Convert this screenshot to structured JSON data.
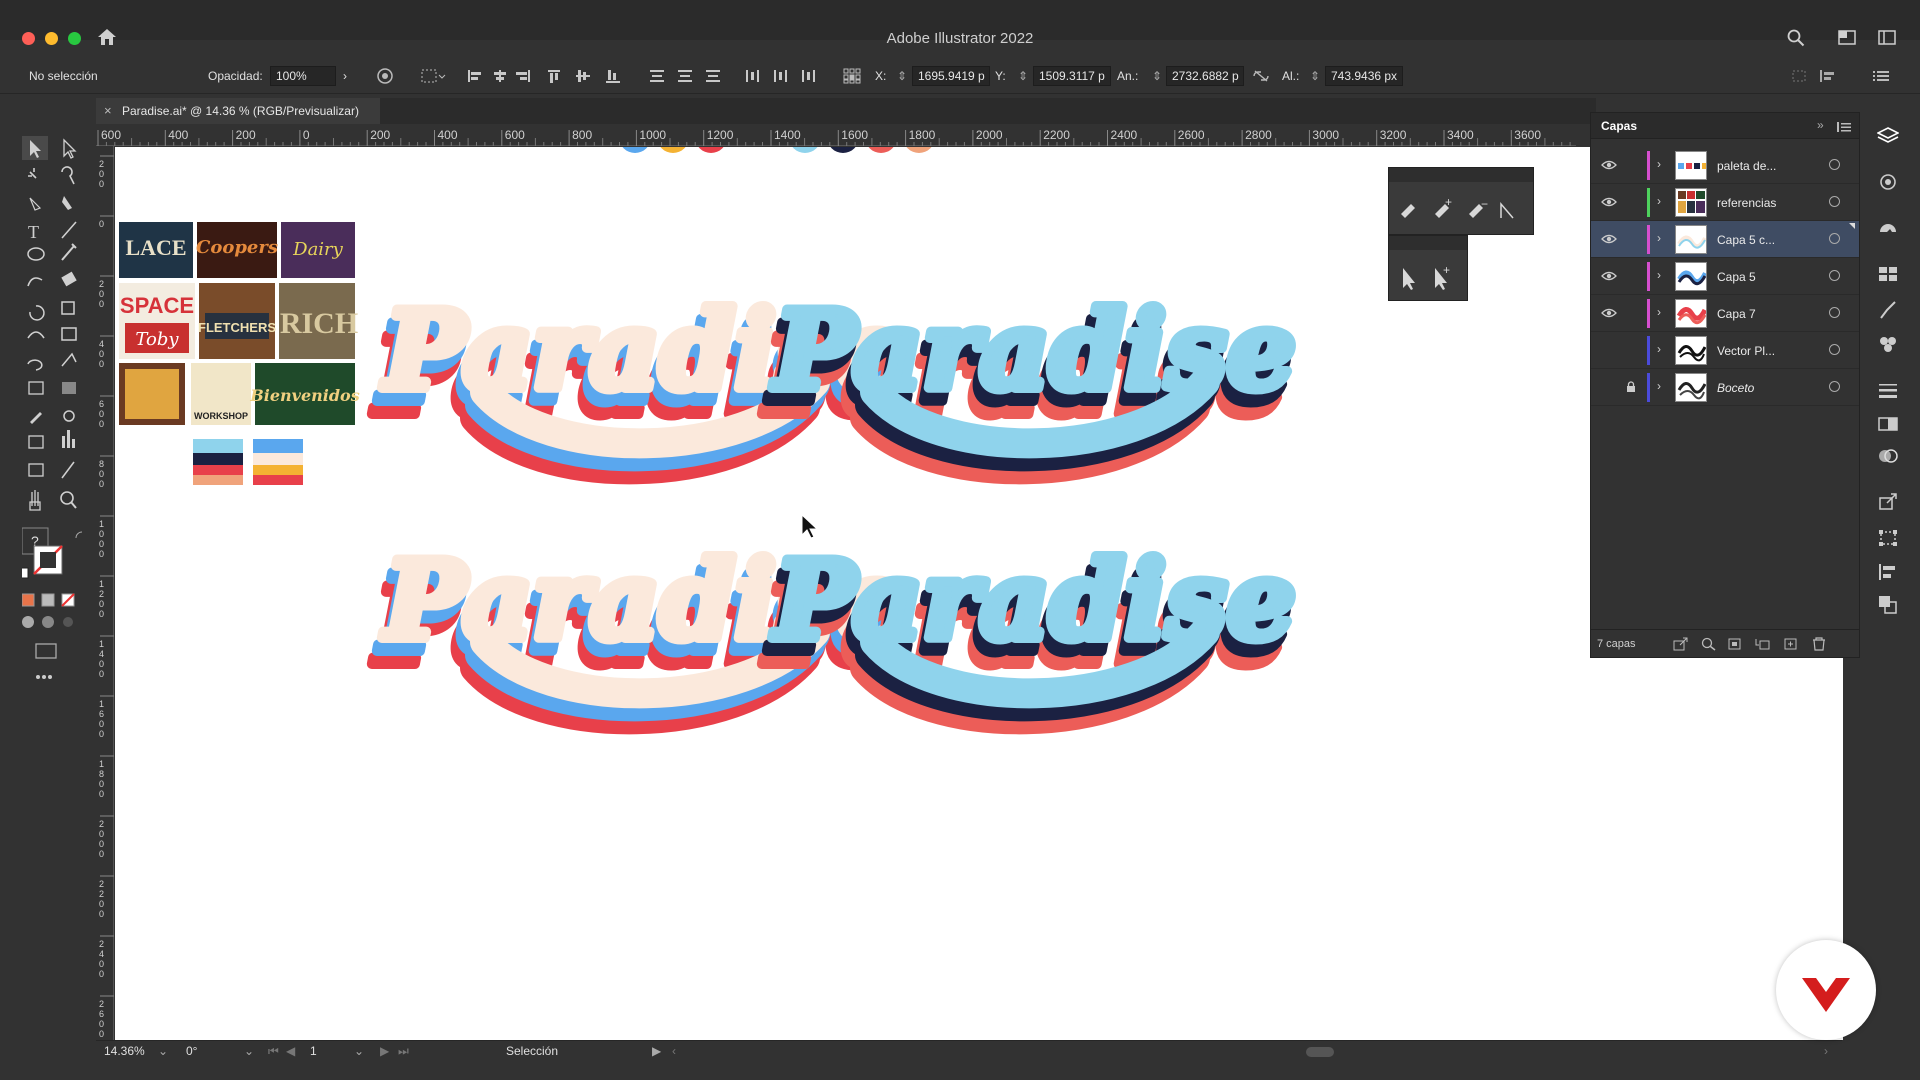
{
  "window": {
    "title": "Adobe Illustrator 2022"
  },
  "control_bar": {
    "selection": "No selección",
    "opacity_label": "Opacidad:",
    "opacity_value": "100%",
    "x_label": "X:",
    "x_value": "1695.9419 p",
    "y_label": "Y:",
    "y_value": "1509.3117 p",
    "w_label": "An.:",
    "w_value": "2732.6882 p",
    "h_label": "Al.:",
    "h_value": "743.9436 px"
  },
  "document_tab": {
    "title": "Paradise.ai* @ 14.36 % (RGB/Previsualizar)",
    "close": "×"
  },
  "ruler": {
    "h_ticks": [
      "600",
      "400",
      "200",
      "0",
      "200",
      "400",
      "600",
      "800",
      "1000",
      "1200",
      "1400",
      "1600",
      "1800",
      "2000",
      "2200",
      "2400",
      "2600",
      "2800",
      "3000",
      "3200",
      "3400",
      "3600"
    ],
    "v_ticks": [
      "200",
      "0",
      "200",
      "400",
      "600",
      "800",
      "1000",
      "1200",
      "1400",
      "1600",
      "1800",
      "2000",
      "2200",
      "2400",
      "2600"
    ]
  },
  "canvas": {
    "artwork_word": "Paradise",
    "reference_signs": [
      "LACE",
      "Coopers",
      "SPACE",
      "Toby",
      "FLETCHERS",
      "RICH",
      "Bienvenidos",
      "WORKSHOP"
    ],
    "colors": {
      "cream": "#fbe9dc",
      "blue": "#5aa7ee",
      "red": "#e8404a",
      "light_blue": "#8fd3ec",
      "navy": "#1b2142",
      "salmon": "#ec5d58"
    }
  },
  "layers_panel": {
    "tab": "Capas",
    "layers": [
      {
        "name": "paleta de...",
        "color": "#d64fcf",
        "visible": true,
        "locked": false,
        "selected": false,
        "italic": false
      },
      {
        "name": "referencias",
        "color": "#4ed25d",
        "visible": true,
        "locked": false,
        "selected": false,
        "italic": false
      },
      {
        "name": "Capa 5 c...",
        "color": "#d64fcf",
        "visible": true,
        "locked": false,
        "selected": true,
        "italic": false
      },
      {
        "name": "Capa 5",
        "color": "#d64fcf",
        "visible": true,
        "locked": false,
        "selected": false,
        "italic": false
      },
      {
        "name": "Capa 7",
        "color": "#d64fcf",
        "visible": true,
        "locked": false,
        "selected": false,
        "italic": false
      },
      {
        "name": "Vector Pl...",
        "color": "#4b4bdb",
        "visible": false,
        "locked": false,
        "selected": false,
        "italic": false
      },
      {
        "name": "Boceto",
        "color": "#4b4bdb",
        "visible": false,
        "locked": true,
        "selected": false,
        "italic": true
      }
    ],
    "count": "7 capas"
  },
  "status_bar": {
    "zoom": "14.36%",
    "rotation": "0°",
    "artboard": "1",
    "tool": "Selección"
  },
  "icons": {
    "home": "home-icon",
    "search": "search-icon",
    "workspace": "workspace-icon",
    "layers": "layers-icon"
  }
}
